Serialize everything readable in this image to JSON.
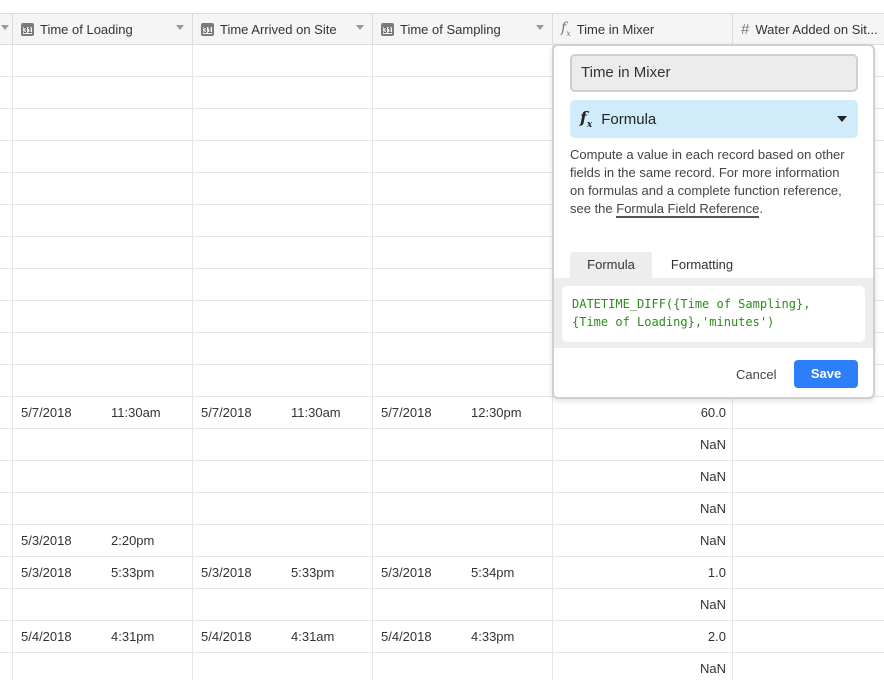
{
  "columns": [
    {
      "label": "Time of Loading",
      "icon": "calendar-icon"
    },
    {
      "label": "Time Arrived on Site",
      "icon": "calendar-icon"
    },
    {
      "label": "Time of Sampling",
      "icon": "calendar-icon"
    },
    {
      "label": "Time in Mixer",
      "icon": "formula-icon"
    },
    {
      "label": "Water Added on Sit...",
      "icon": "number-icon"
    }
  ],
  "calendar_icon_text": "31",
  "rows": [
    {
      "load_date": "5/7/2018",
      "load_time": "11:30am",
      "arrive_date": "5/7/2018",
      "arrive_time": "11:30am",
      "sample_date": "5/7/2018",
      "sample_time": "12:30pm",
      "mixer": "60.0"
    },
    {
      "load_date": "",
      "load_time": "",
      "arrive_date": "",
      "arrive_time": "",
      "sample_date": "",
      "sample_time": "",
      "mixer": "NaN"
    },
    {
      "load_date": "",
      "load_time": "",
      "arrive_date": "",
      "arrive_time": "",
      "sample_date": "",
      "sample_time": "",
      "mixer": "NaN"
    },
    {
      "load_date": "",
      "load_time": "",
      "arrive_date": "",
      "arrive_time": "",
      "sample_date": "",
      "sample_time": "",
      "mixer": "NaN"
    },
    {
      "load_date": "5/3/2018",
      "load_time": "2:20pm",
      "arrive_date": "",
      "arrive_time": "",
      "sample_date": "",
      "sample_time": "",
      "mixer": "NaN"
    },
    {
      "load_date": "5/3/2018",
      "load_time": "5:33pm",
      "arrive_date": "5/3/2018",
      "arrive_time": "5:33pm",
      "sample_date": "5/3/2018",
      "sample_time": "5:34pm",
      "mixer": "1.0"
    },
    {
      "load_date": "",
      "load_time": "",
      "arrive_date": "",
      "arrive_time": "",
      "sample_date": "",
      "sample_time": "",
      "mixer": "NaN"
    },
    {
      "load_date": "5/4/2018",
      "load_time": "4:31pm",
      "arrive_date": "5/4/2018",
      "arrive_time": "4:31am",
      "sample_date": "5/4/2018",
      "sample_time": "4:33pm",
      "mixer": "2.0"
    },
    {
      "load_date": "",
      "load_time": "",
      "arrive_date": "",
      "arrive_time": "",
      "sample_date": "",
      "sample_time": "",
      "mixer": "NaN"
    }
  ],
  "field_editor": {
    "field_name": "Time in Mixer",
    "field_type": "Formula",
    "description_prefix": "Compute a value in each record based on other fields in the same record. For more information on formulas and a complete function reference, see the ",
    "description_link": "Formula Field Reference",
    "description_suffix": ".",
    "tabs": [
      "Formula",
      "Formatting"
    ],
    "active_tab": "Formula",
    "formula": "DATETIME_DIFF({Time of Sampling},\n{Time of Loading},'minutes')",
    "cancel_label": "Cancel",
    "save_label": "Save",
    "accent_color": "#2d7ff9",
    "type_bg_color": "#d0ecfb",
    "formula_text_color": "#2e8b1e"
  }
}
